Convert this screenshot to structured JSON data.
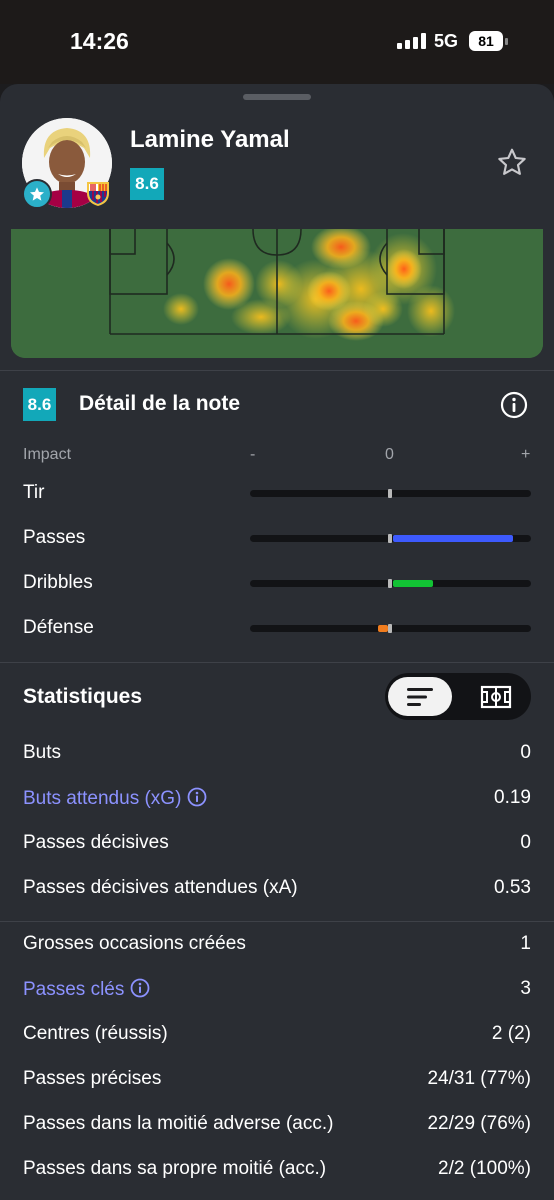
{
  "status_bar": {
    "time": "14:26",
    "network": "5G",
    "battery": "81"
  },
  "player": {
    "name": "Lamine Yamal",
    "rating": "8.6"
  },
  "rating_detail": {
    "badge": "8.6",
    "title": "Détail de la note",
    "impact_label": "Impact",
    "scale": {
      "minus": "-",
      "zero": "0",
      "plus": "+"
    },
    "rows": [
      {
        "label": "Tir",
        "impact": 0,
        "color": "#9e9e9e"
      },
      {
        "label": "Passes",
        "impact": 0.87,
        "color": "#3d5afe"
      },
      {
        "label": "Dribbles",
        "impact": 0.29,
        "color": "#12c234"
      },
      {
        "label": "Défense",
        "impact": -0.07,
        "color": "#f07c1e"
      }
    ]
  },
  "stats": {
    "title": "Statistiques",
    "group1": [
      {
        "label": "Buts",
        "value": "0",
        "link": false,
        "info": false
      },
      {
        "label": "Buts attendus (xG)",
        "value": "0.19",
        "link": true,
        "info": true
      },
      {
        "label": "Passes décisives",
        "value": "0",
        "link": false,
        "info": false
      },
      {
        "label": "Passes décisives attendues (xA)",
        "value": "0.53",
        "link": false,
        "info": false
      }
    ],
    "group2": [
      {
        "label": "Grosses occasions créées",
        "value": "1",
        "link": false,
        "info": false
      },
      {
        "label": "Passes clés",
        "value": "3",
        "link": true,
        "info": true
      },
      {
        "label": "Centres (réussis)",
        "value": "2 (2)",
        "link": false,
        "info": false
      },
      {
        "label": "Passes précises",
        "value": "24/31 (77%)",
        "link": false,
        "info": false
      },
      {
        "label": "Passes dans la moitié adverse (acc.)",
        "value": "22/29 (76%)",
        "link": false,
        "info": false
      },
      {
        "label": "Passes dans sa propre moitié (acc.)",
        "value": "2/2 (100%)",
        "link": false,
        "info": false
      }
    ]
  },
  "colors": {
    "accent_rating": "#12a8b9",
    "link": "#8c92ff",
    "pitch": "#3c6b3d",
    "sheet": "#2a2d33"
  },
  "icons": [
    "star-icon",
    "favorite-star-icon",
    "info-icon",
    "list-view-icon",
    "pitch-view-icon",
    "barcelona-crest-icon"
  ]
}
